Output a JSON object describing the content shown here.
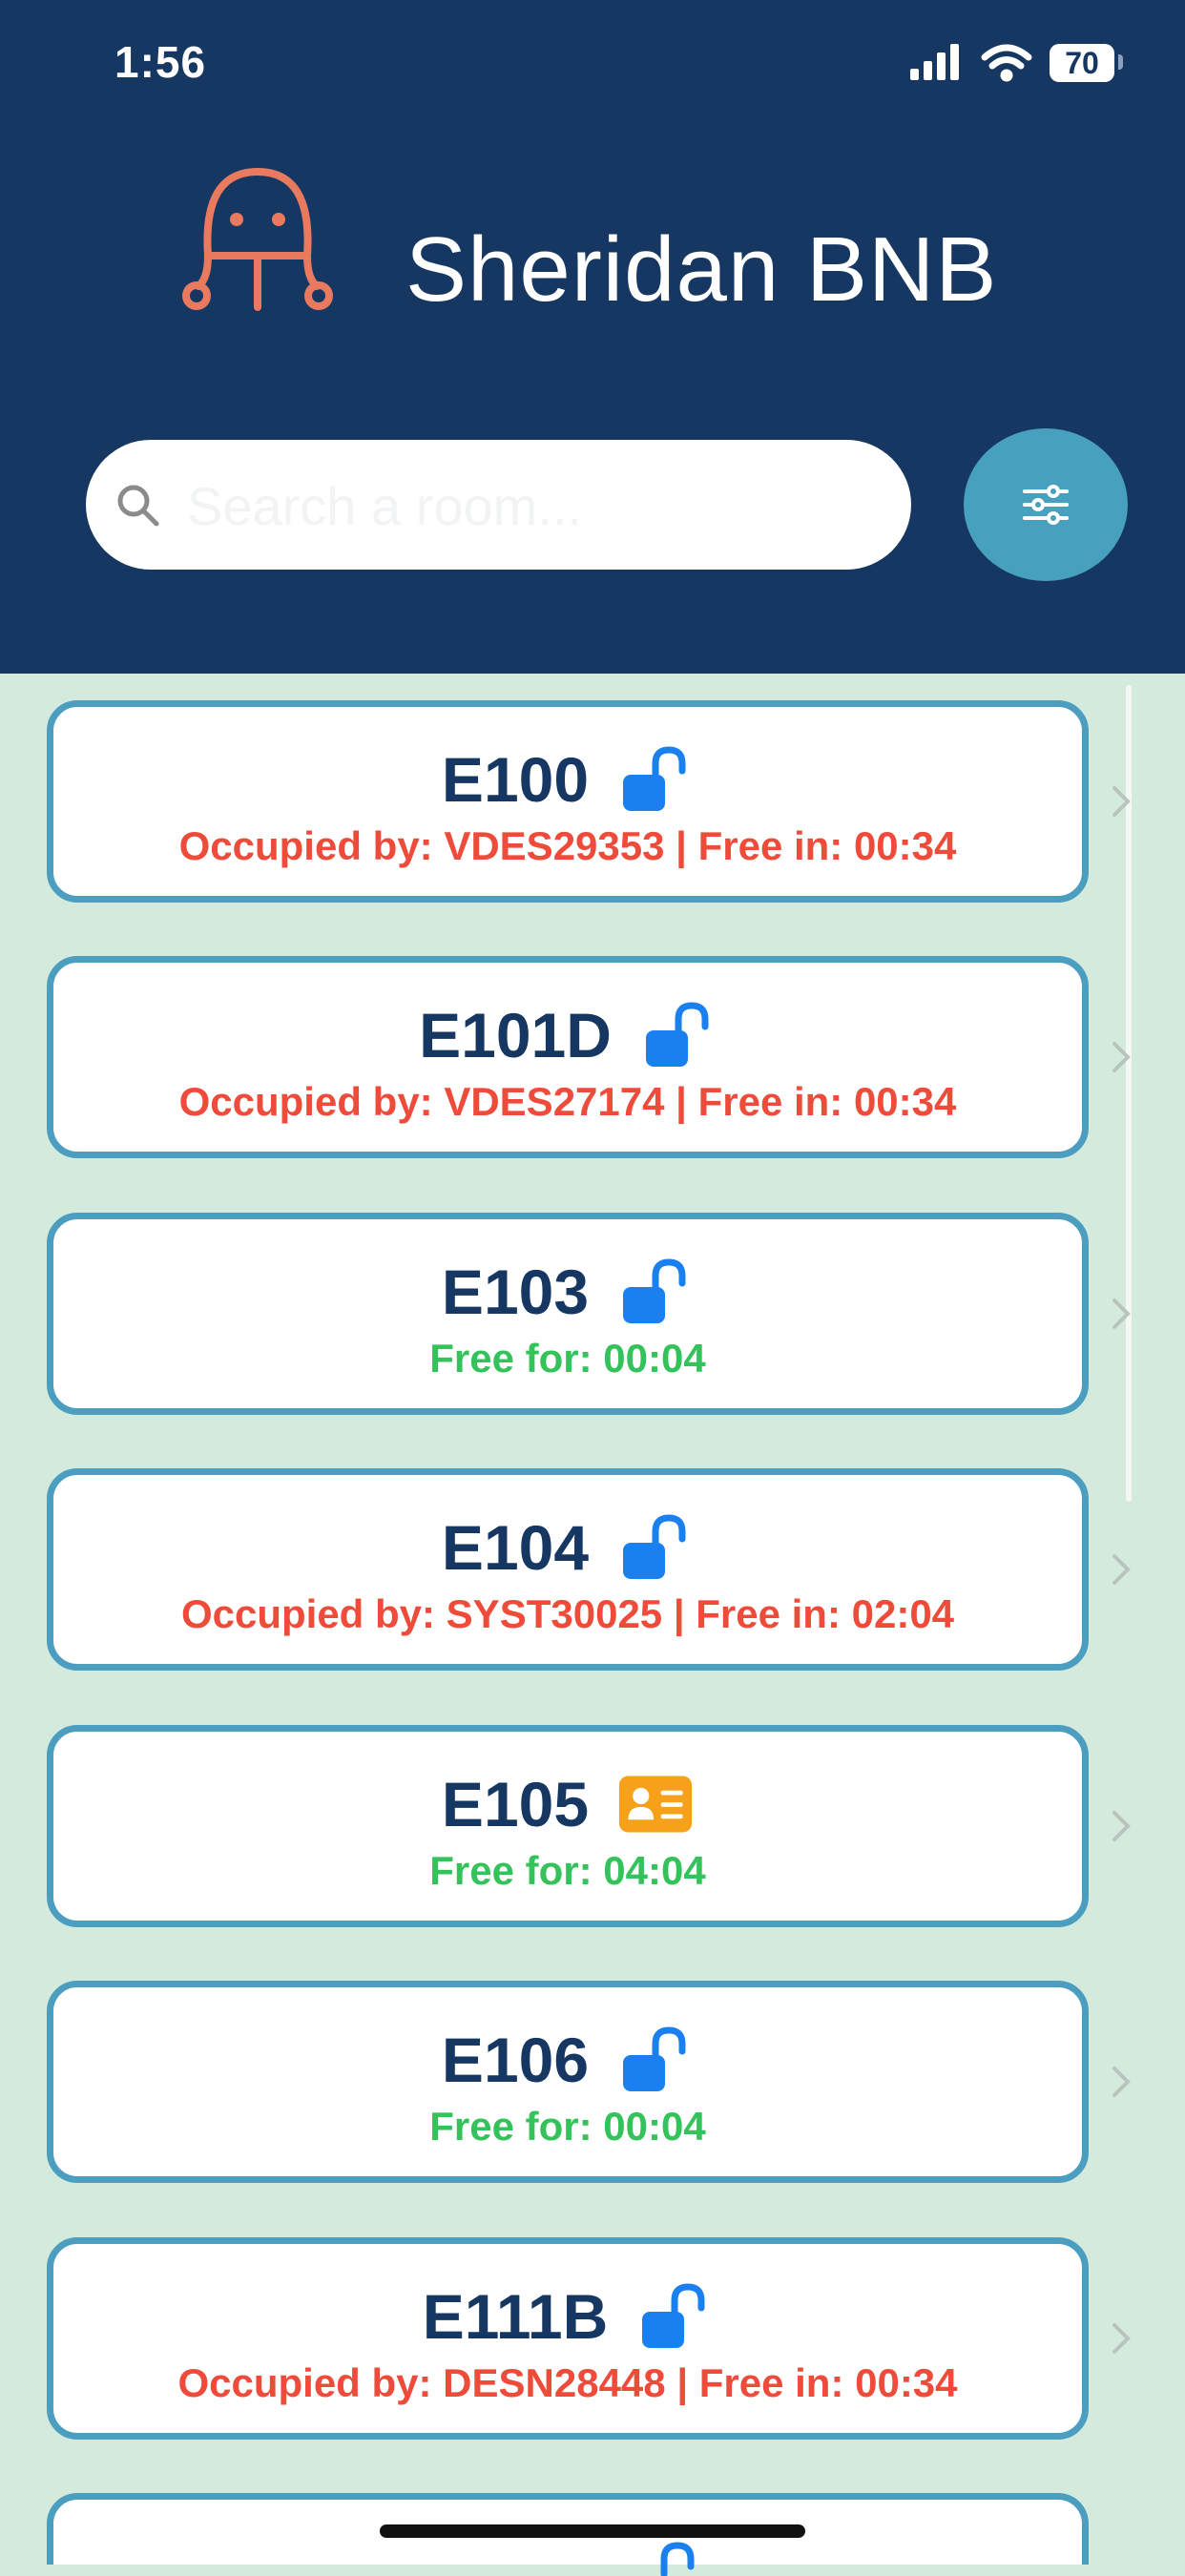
{
  "status_bar": {
    "time": "1:56",
    "battery": "70"
  },
  "header": {
    "title": "Sheridan BNB"
  },
  "search": {
    "placeholder": "Search a room..."
  },
  "colors": {
    "header_bg": "#163762",
    "accent": "#47a0bd",
    "occupied": "#ee4b3b",
    "free": "#34c25a",
    "lock_icon": "#1a80f0",
    "card_icon": "#f7a019",
    "list_bg": "#d3eadc"
  },
  "rooms": [
    {
      "name": "E100",
      "status": "Occupied by: VDES29353 | Free in: 00:34",
      "state": "occupied",
      "icon": "unlocked-padlock-icon"
    },
    {
      "name": "E101D",
      "status": "Occupied by: VDES27174 | Free in: 00:34",
      "state": "occupied",
      "icon": "unlocked-padlock-icon"
    },
    {
      "name": "E103",
      "status": "Free for: 00:04",
      "state": "free",
      "icon": "unlocked-padlock-icon"
    },
    {
      "name": "E104",
      "status": "Occupied by: SYST30025 | Free in: 02:04",
      "state": "occupied",
      "icon": "unlocked-padlock-icon"
    },
    {
      "name": "E105",
      "status": "Free for: 04:04",
      "state": "free",
      "icon": "id-card-icon"
    },
    {
      "name": "E106",
      "status": "Free for: 00:04",
      "state": "free",
      "icon": "unlocked-padlock-icon"
    },
    {
      "name": "E111B",
      "status": "Occupied by: DESN28448 | Free in: 00:34",
      "state": "occupied",
      "icon": "unlocked-padlock-icon"
    }
  ]
}
